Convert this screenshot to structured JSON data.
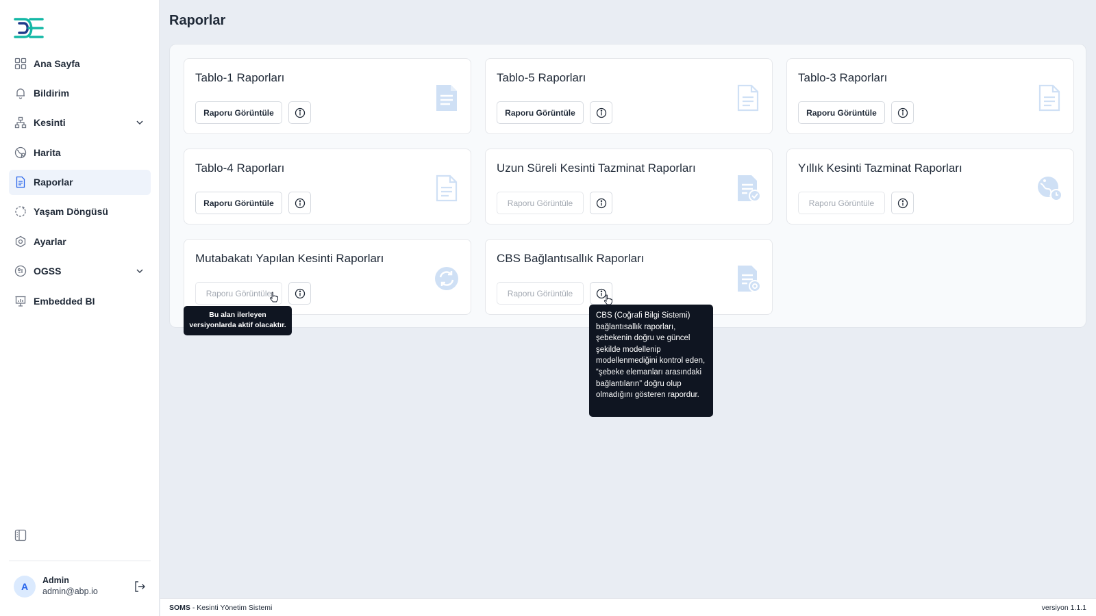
{
  "sidebar": {
    "items": [
      {
        "label": "Ana Sayfa"
      },
      {
        "label": "Bildirim"
      },
      {
        "label": "Kesinti"
      },
      {
        "label": "Harita"
      },
      {
        "label": "Raporlar"
      },
      {
        "label": "Yaşam Döngüsü"
      },
      {
        "label": "Ayarlar"
      },
      {
        "label": "OGSS"
      },
      {
        "label": "Embedded BI"
      }
    ],
    "active_item": "Raporlar"
  },
  "user": {
    "initial": "A",
    "name": "Admin",
    "email": "admin@abp.io"
  },
  "page": {
    "title": "Raporlar"
  },
  "cards": [
    {
      "title": "Tablo-1 Raporları",
      "button": "Raporu Görüntüle",
      "enabled": true,
      "icon": "document-icon"
    },
    {
      "title": "Tablo-5 Raporları",
      "button": "Raporu Görüntüle",
      "enabled": true,
      "icon": "document-outline-icon"
    },
    {
      "title": "Tablo-3 Raporları",
      "button": "Raporu Görüntüle",
      "enabled": true,
      "icon": "document-outline-icon"
    },
    {
      "title": "Tablo-4 Raporları",
      "button": "Raporu Görüntüle",
      "enabled": true,
      "icon": "document-outline-icon"
    },
    {
      "title": "Uzun Süreli Kesinti Tazminat Raporları",
      "button": "Raporu Görüntüle",
      "enabled": false,
      "icon": "document-check-icon"
    },
    {
      "title": "Yıllık Kesinti Tazminat Raporları",
      "button": "Raporu Görüntüle",
      "enabled": false,
      "icon": "globe-clock-icon"
    },
    {
      "title": "Mutabakatı Yapılan Kesinti Raporları",
      "button": "Raporu Görüntüle",
      "enabled": false,
      "icon": "refresh-circle-icon"
    },
    {
      "title": "CBS Bağlantısallık Raporları",
      "button": "Raporu Görüntüle",
      "enabled": false,
      "icon": "document-settings-icon"
    }
  ],
  "tooltips": {
    "disabled_notice": "Bu alan ilerleyen versiyonlarda aktif olacaktır.",
    "cbs_info": "CBS (Coğrafi Bilgi Sistemi) bağlantısallık raporları, şebekenin doğru ve güncel şekilde modellenip modellenmediğini kontrol eden, “şebeke elemanları arasındaki bağlantıların” doğru olup olmadığını gösteren rapordur."
  },
  "footer": {
    "app_name": "SOMS",
    "app_desc": " - Kesinti Yönetim Sistemi",
    "version": "versiyon 1.1.1"
  },
  "colors": {
    "accent": "#2563eb",
    "active_bg": "#eef3fb",
    "icon_light": "#cfe0f5",
    "tooltip_bg": "#0f1521"
  }
}
